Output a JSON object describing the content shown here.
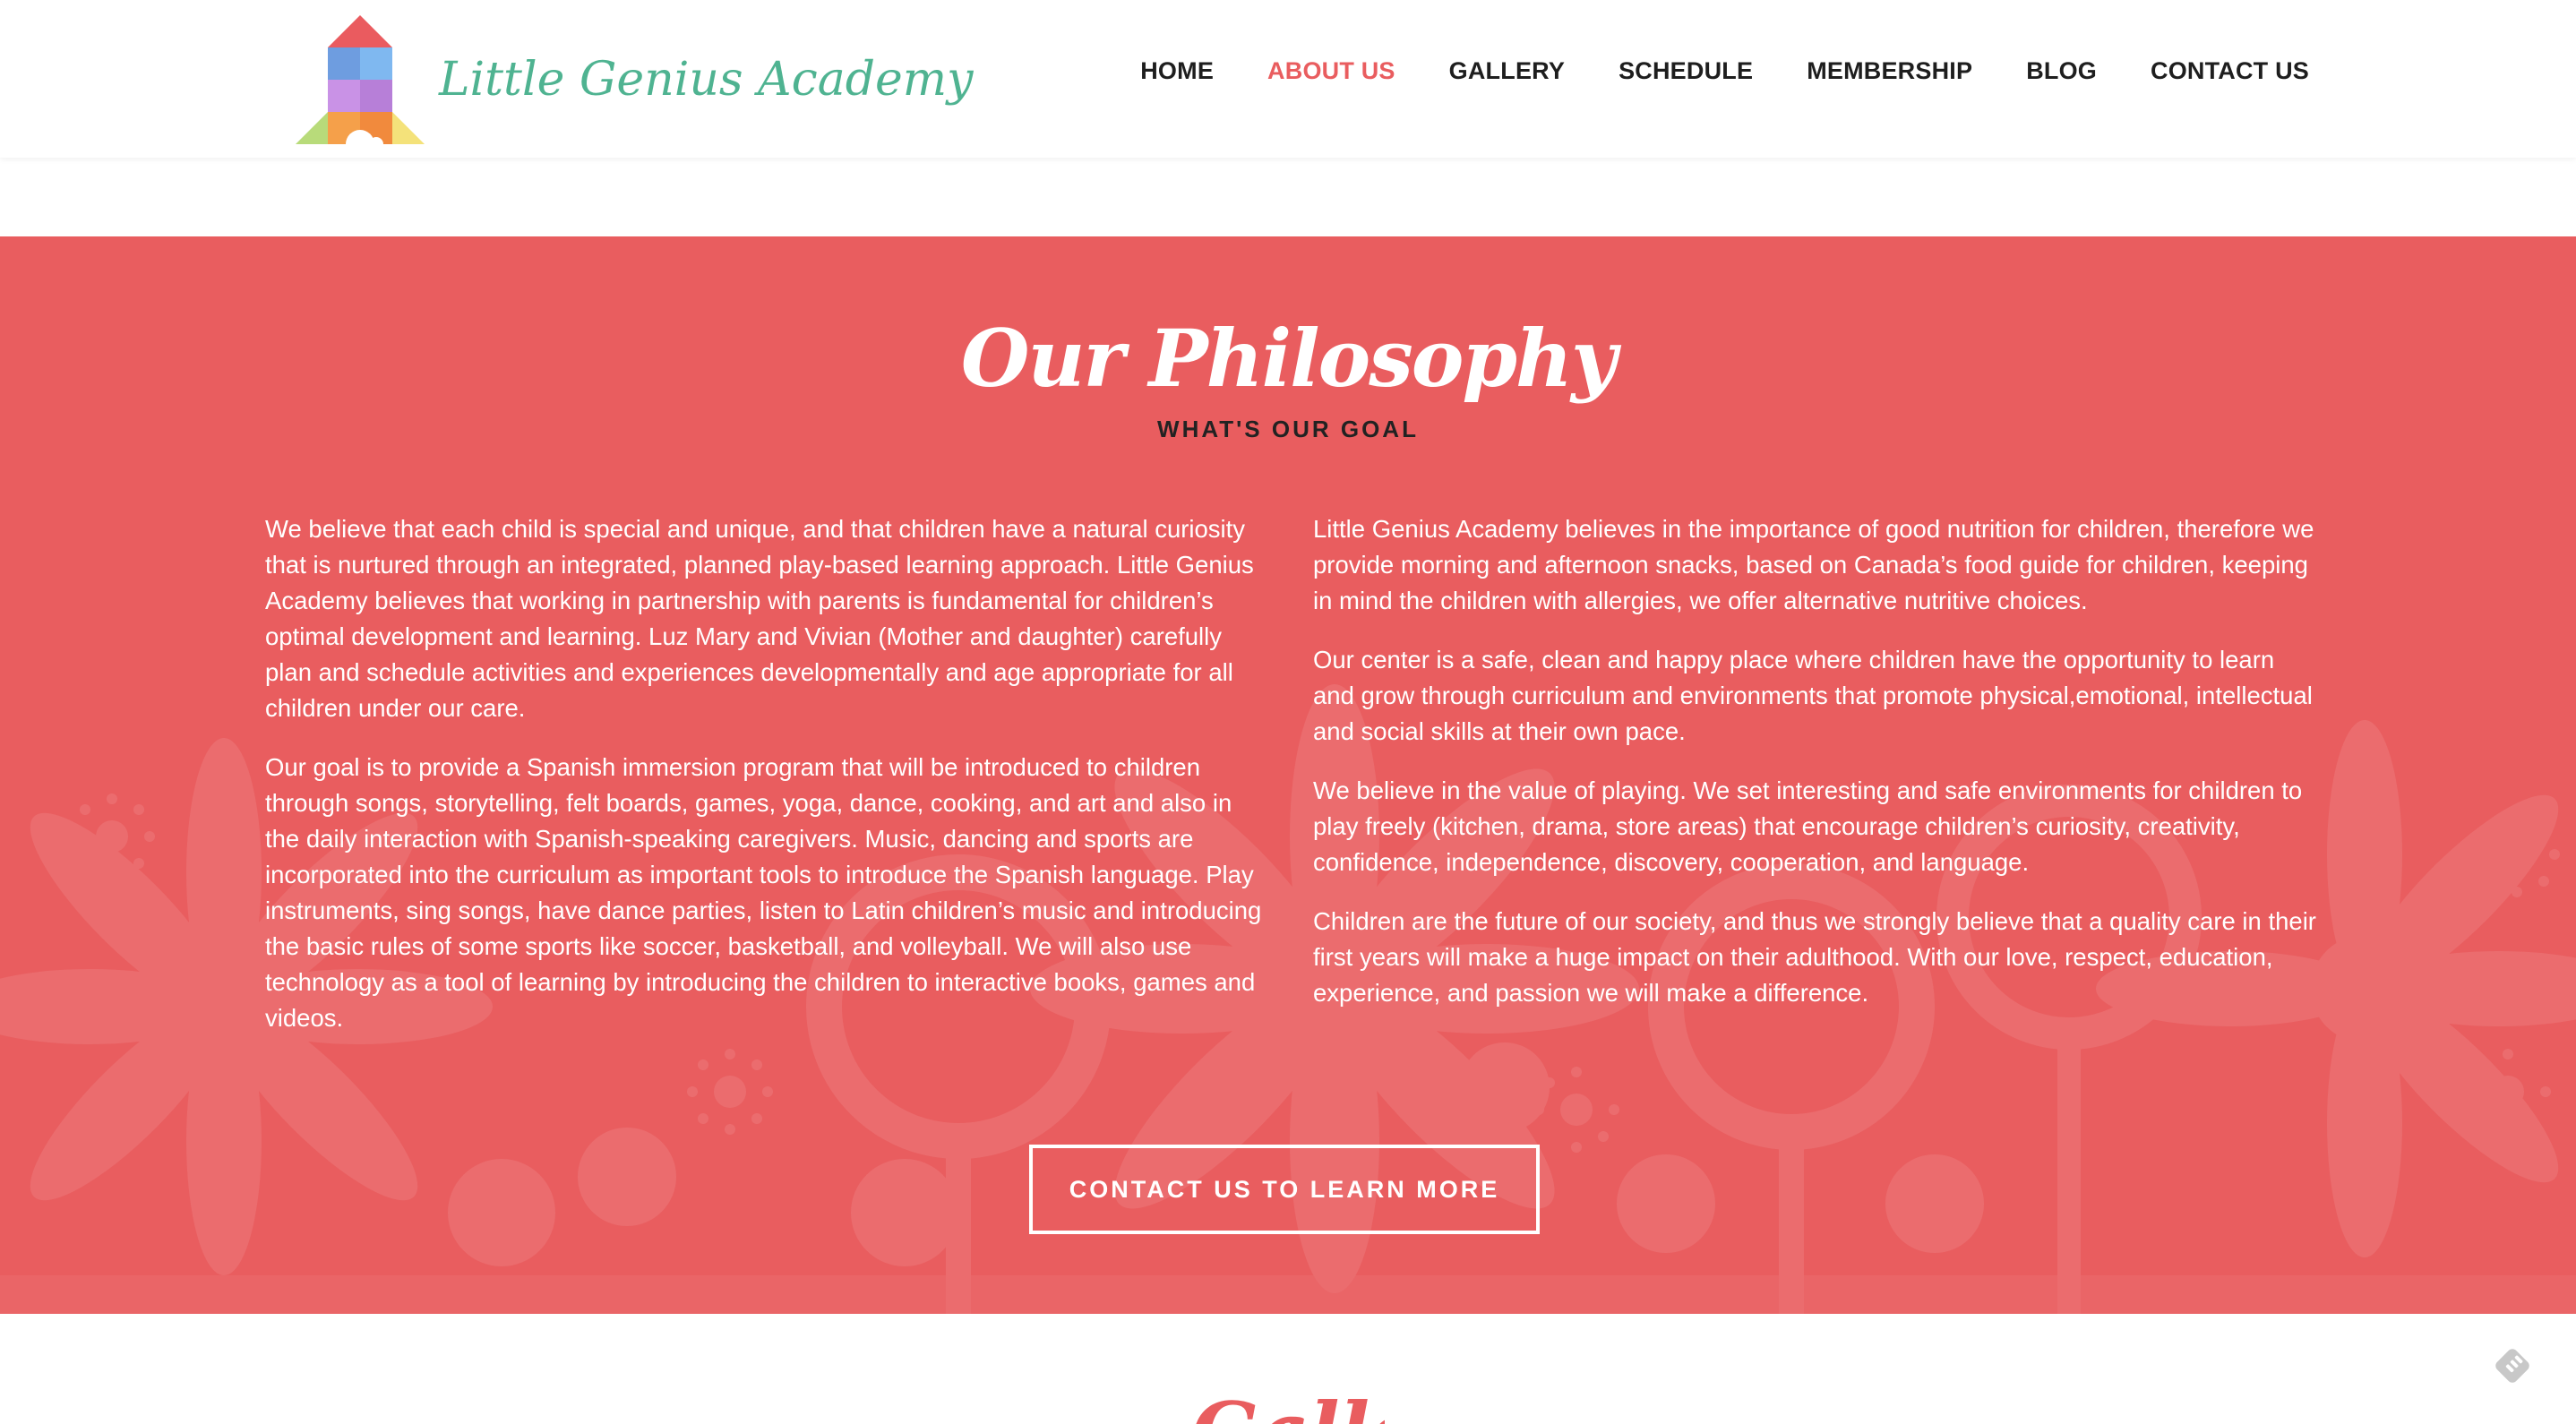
{
  "header": {
    "logo_text": "Little Genius Academy",
    "nav": [
      {
        "label": "HOME",
        "active": false
      },
      {
        "label": "ABOUT US",
        "active": true
      },
      {
        "label": "GALLERY",
        "active": false
      },
      {
        "label": "SCHEDULE",
        "active": false
      },
      {
        "label": "MEMBERSHIP",
        "active": false
      },
      {
        "label": "BLOG",
        "active": false
      },
      {
        "label": "CONTACT US",
        "active": false
      }
    ]
  },
  "philosophy": {
    "title": "Our Philosophy",
    "subtitle": "WHAT'S OUR GOAL",
    "left_paragraphs": [
      "We believe that each child is special and unique, and that children have a natural curiosity that is nurtured through an integrated, planned play-based learning approach. Little Genius Academy believes that working in partnership with parents is fundamental for children’s optimal development and learning. Luz Mary and Vivian (Mother and daughter) carefully plan and schedule activities and experiences developmentally and age appropriate for all children under our care.",
      "Our goal is to provide a Spanish immersion program that will be introduced to children through songs, storytelling, felt boards, games, yoga, dance, cooking, and art and also in the daily interaction with Spanish-speaking caregivers. Music, dancing and sports are incorporated into the curriculum as important tools to introduce the Spanish language. Play instruments, sing songs, have dance parties, listen to Latin children’s music and introducing the basic rules of some sports like soccer, basketball, and volleyball. We will also use technology as a tool of learning by introducing the children to interactive books, games and videos."
    ],
    "right_paragraphs": [
      "Little Genius Academy believes in the importance of good nutrition for children, therefore we provide morning and afternoon snacks, based on Canada’s food guide for children, keeping in mind the children with allergies, we offer alternative nutritive choices.",
      "Our center is a safe, clean and happy place where children have the opportunity to learn and grow through curriculum and environments that promote physical,emotional, intellectual and social skills at their own pace.",
      "We believe in the value of playing. We set interesting and safe environments for children to play freely (kitchen, drama, store areas) that encourage children’s curiosity, creativity, confidence, independence, discovery, cooperation, and language.",
      "Children are the future of our society, and thus we strongly believe that a quality care in their first years will make a huge impact on their adulthood. With our love, respect, education, experience, and passion we will make a difference."
    ],
    "cta_label": "CONTACT US TO LEARN MORE"
  },
  "next_section": {
    "title_partial": "Gallery"
  },
  "colors": {
    "accent": "#e95d5f",
    "logo_green": "#4fb391",
    "nav_text": "#1e1e1e"
  },
  "icons": [
    "logo-house-blocks-icon",
    "feedly-icon",
    "flower-pattern"
  ]
}
